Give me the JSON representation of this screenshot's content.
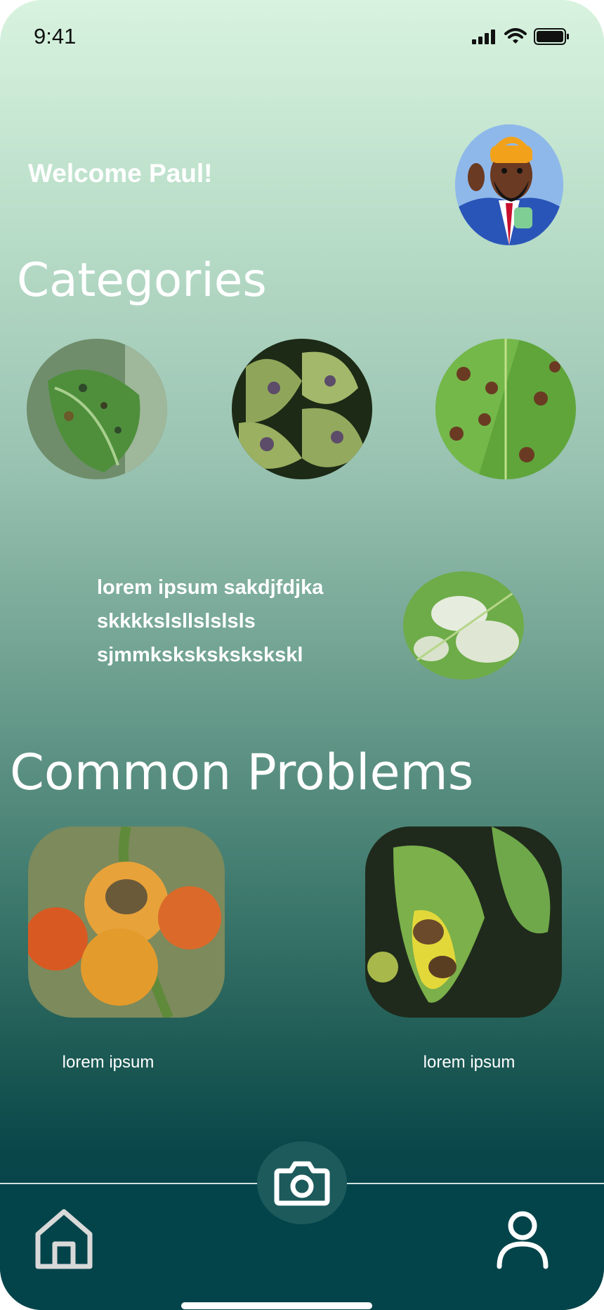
{
  "status": {
    "time": "9:41"
  },
  "header": {
    "welcome": "Welcome Paul!"
  },
  "categories": {
    "title": "Categories",
    "info_text": "lorem ipsum sakdjfdjka skkkkslsllslslsls sjmmkskskskskskskl"
  },
  "common_problems": {
    "title": "Common Problems",
    "items": [
      {
        "label": "lorem ipsum"
      },
      {
        "label": "lorem ipsum"
      }
    ]
  },
  "nav": {
    "icons": [
      "home-icon",
      "camera-icon",
      "profile-icon"
    ]
  }
}
